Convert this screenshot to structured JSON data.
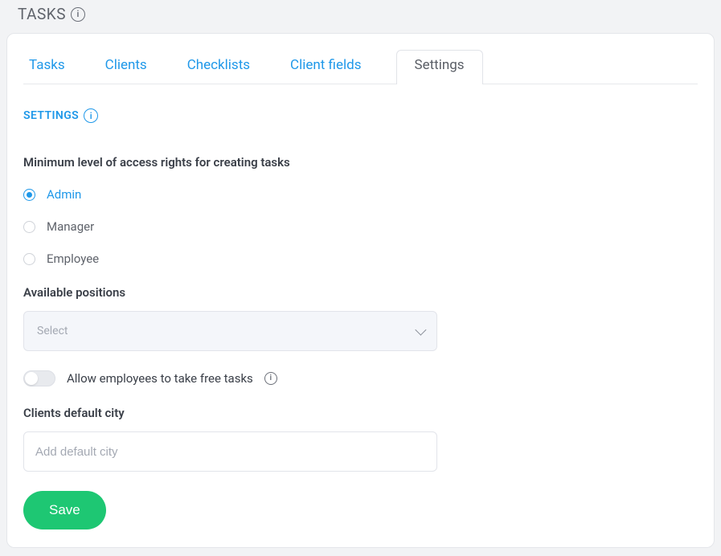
{
  "page": {
    "title": "TASKS"
  },
  "tabs": {
    "tasks": "Tasks",
    "clients": "Clients",
    "checklists": "Checklists",
    "client_fields": "Client fields",
    "settings": "Settings"
  },
  "section": {
    "heading": "SETTINGS"
  },
  "access": {
    "label": "Minimum level of access rights for creating tasks",
    "options": {
      "admin": "Admin",
      "manager": "Manager",
      "employee": "Employee"
    }
  },
  "positions": {
    "label": "Available positions",
    "placeholder": "Select"
  },
  "toggle": {
    "label": "Allow employees to take free tasks"
  },
  "city": {
    "label": "Clients default city",
    "placeholder": "Add default city"
  },
  "buttons": {
    "save": "Save"
  }
}
